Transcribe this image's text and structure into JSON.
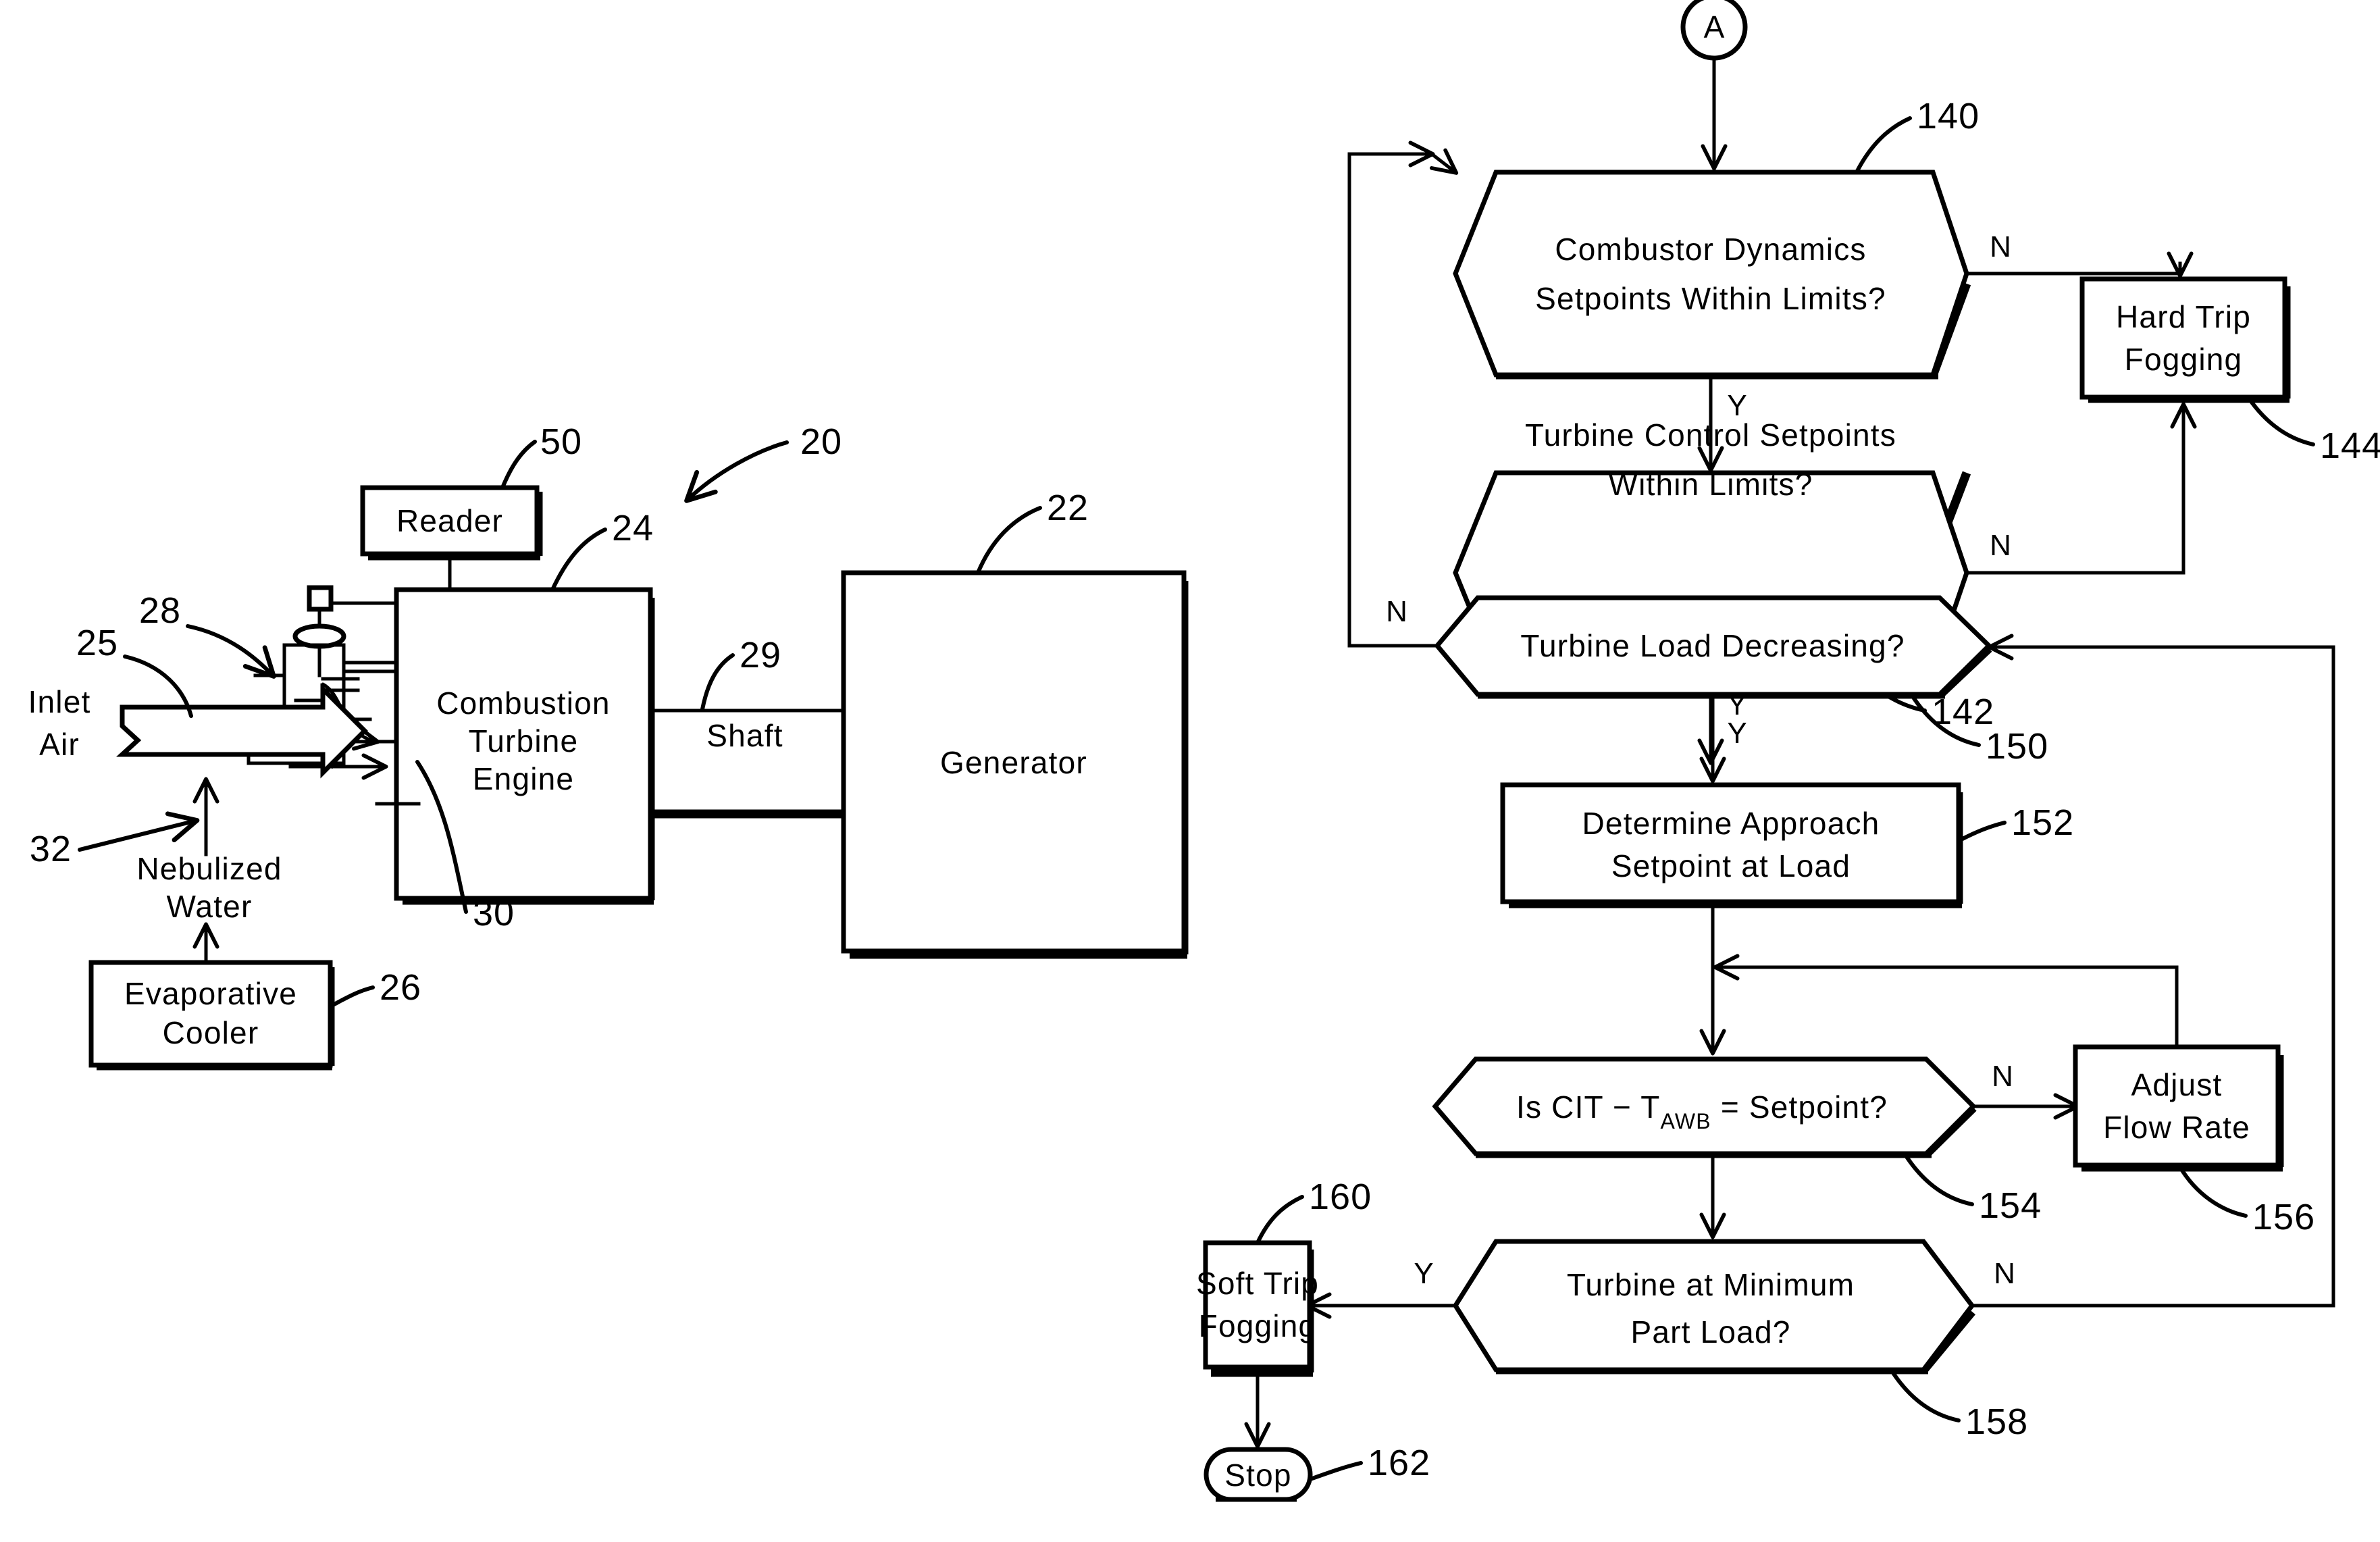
{
  "figure": {
    "domain": "patent-diagram",
    "left_diagram": {
      "system_ref": "20",
      "inlet_air_label": "Inlet\nAir",
      "inlet_air_line1": "Inlet",
      "inlet_air_line2": "Air",
      "inlet_air_ref": "25",
      "nebulized_water_line1": "Nebulized",
      "nebulized_water_line2": "Water",
      "nebulized_water_ref": "32",
      "evaporative_cooler_line1": "Evaporative",
      "evaporative_cooler_line2": "Cooler",
      "evaporative_cooler_ref": "26",
      "reader_label": "Reader",
      "reader_ref": "50",
      "fogging_skid_ref": "28",
      "engine_line1": "Combustion",
      "engine_line2": "Turbine",
      "engine_line3": "Engine",
      "engine_ref": "24",
      "engine_inlet_ref": "30",
      "shaft_label": "Shaft",
      "shaft_ref": "29",
      "generator_label": "Generator",
      "generator_ref": "22"
    },
    "flowchart": {
      "connector_label": "A",
      "nodes": [
        {
          "id": "n140",
          "ref": "140",
          "shape": "decision",
          "line1": "Combustor  Dynamics",
          "line2": "Setpoints  Within  Limits?",
          "yes_label": "Y",
          "no_label": "N"
        },
        {
          "id": "n142",
          "ref": "142",
          "shape": "decision",
          "line1": "Turbine  Control  Setpoints",
          "line2": "Within  Limits?",
          "yes_label": "Y",
          "no_label": "N"
        },
        {
          "id": "n144",
          "ref": "144",
          "shape": "process",
          "line1": "Hard  Trip",
          "line2": "Fogging"
        },
        {
          "id": "n150",
          "ref": "150",
          "shape": "decision",
          "line1": "Turbine  Load  Decreasing?",
          "line2": "",
          "yes_label": "Y",
          "no_label": "N"
        },
        {
          "id": "n152",
          "ref": "152",
          "shape": "process",
          "line1": "Determine  Approach",
          "line2": "Setpoint  at  Load"
        },
        {
          "id": "n154",
          "ref": "154",
          "shape": "decision",
          "text_prefix": "Is  CIT  −  T",
          "text_sub": "AWB",
          "text_suffix": "  =  Setpoint?",
          "yes_label": "",
          "no_label": "N"
        },
        {
          "id": "n156",
          "ref": "156",
          "shape": "process",
          "line1": "Adjust",
          "line2": "Flow  Rate"
        },
        {
          "id": "n158",
          "ref": "158",
          "shape": "decision",
          "line1": "Turbine  at  Minimum",
          "line2": "Part  Load?",
          "yes_label": "Y",
          "no_label": "N"
        },
        {
          "id": "n160",
          "ref": "160",
          "shape": "process",
          "line1": "Soft  Trip",
          "line2": "Fogging"
        },
        {
          "id": "n162",
          "ref": "162",
          "shape": "terminator",
          "line1": "Stop"
        }
      ]
    }
  },
  "colors": {
    "ink": "#000000",
    "paper": "#ffffff"
  }
}
